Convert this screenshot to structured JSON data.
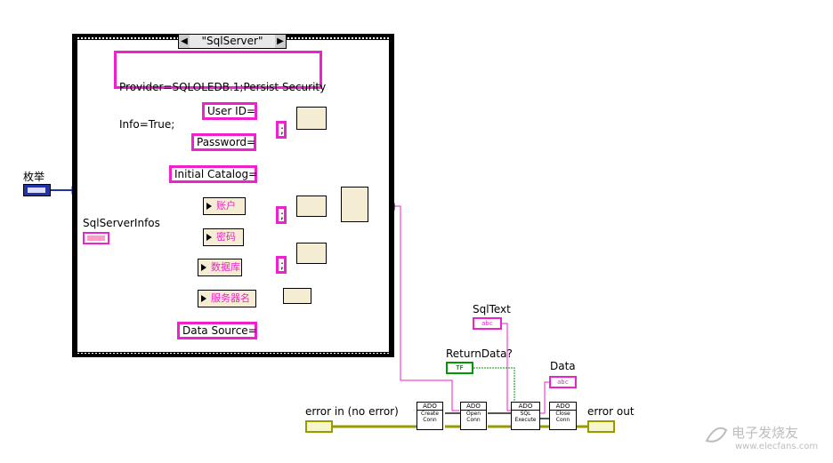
{
  "enum_control": {
    "label": "枚举"
  },
  "case_structure": {
    "selector_value": "\"SqlServer\""
  },
  "strings": {
    "provider_line1": "Provider=SQLOLEDB.1;Persist Security",
    "provider_line2": "Info=True;",
    "user_id": "User ID=",
    "password": "Password=",
    "initial_catalog": "Initial Catalog=",
    "data_source": "Data Source=",
    "semicolon": ";"
  },
  "cluster": {
    "label": "SqlServerInfos"
  },
  "unbundle_items": [
    "账户",
    "密码",
    "数据库",
    "服务器名"
  ],
  "controls": {
    "sqltext": "SqlText",
    "returndata": "ReturnData?",
    "data": "Data",
    "error_in": "error in (no error)",
    "error_out": "error out"
  },
  "ado_blocks": [
    {
      "header": "ADO",
      "lines": [
        "Create",
        "Conn"
      ]
    },
    {
      "header": "ADO",
      "lines": [
        "Open",
        "Conn"
      ]
    },
    {
      "header": "ADO",
      "lines": [
        "SQL",
        "Execute"
      ]
    },
    {
      "header": "ADO",
      "lines": [
        "Close",
        "Conn"
      ]
    }
  ],
  "terminals": {
    "abc": "abc",
    "tf": "TF"
  },
  "watermark": {
    "cn": "电子发烧友",
    "url": "www.elecfans.com"
  },
  "colors": {
    "string_wire": "#ee22cc",
    "error_wire": "#999900",
    "enum_wire": "#2233aa",
    "bool_wire": "#009900"
  }
}
